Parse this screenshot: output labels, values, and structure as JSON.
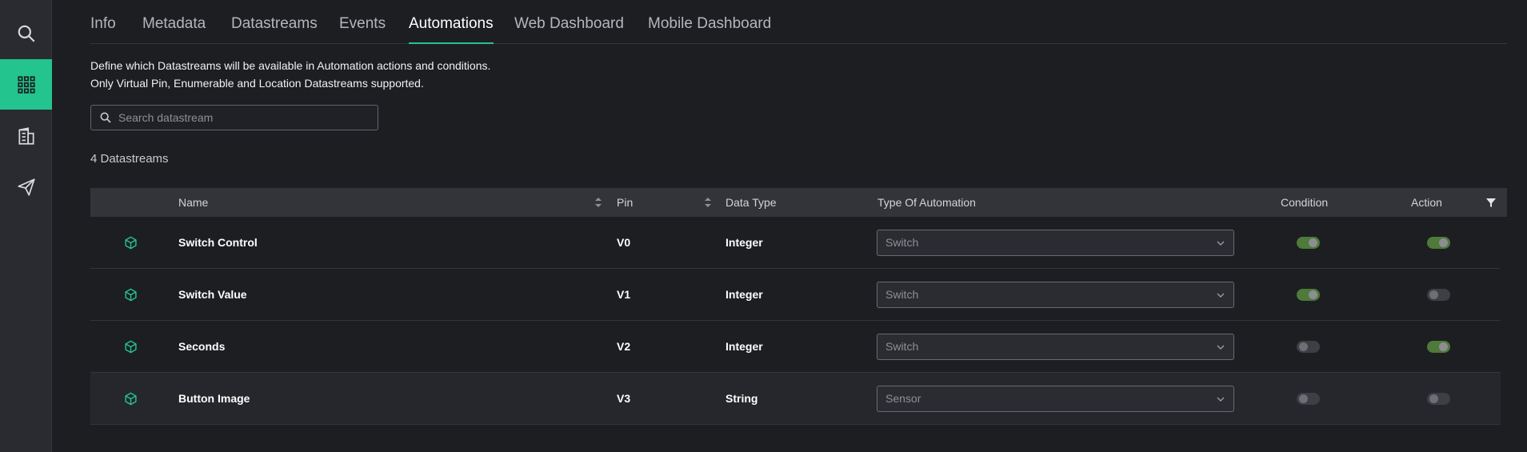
{
  "sidebar": {
    "items": [
      {
        "icon": "search-icon"
      },
      {
        "icon": "grid-icon",
        "active": true
      },
      {
        "icon": "building-icon"
      },
      {
        "icon": "send-icon"
      }
    ]
  },
  "tabs": [
    "Info",
    "Metadata",
    "Datastreams",
    "Events",
    "Automations",
    "Web Dashboard",
    "Mobile Dashboard"
  ],
  "active_tab": "Automations",
  "description": {
    "line1": "Define which Datastreams will be available in Automation actions and conditions.",
    "line2": "Only Virtual Pin, Enumerable and Location Datastreams supported."
  },
  "search": {
    "placeholder": "Search datastream",
    "value": ""
  },
  "count_label": "4 Datastreams",
  "table": {
    "headers": {
      "name": "Name",
      "pin": "Pin",
      "data_type": "Data Type",
      "type_of_automation": "Type Of Automation",
      "condition": "Condition",
      "action": "Action"
    },
    "rows": [
      {
        "name": "Switch Control",
        "pin": "V0",
        "data_type": "Integer",
        "automation": "Switch",
        "condition": true,
        "action": true
      },
      {
        "name": "Switch Value",
        "pin": "V1",
        "data_type": "Integer",
        "automation": "Switch",
        "condition": true,
        "action": false
      },
      {
        "name": "Seconds",
        "pin": "V2",
        "data_type": "Integer",
        "automation": "Switch",
        "condition": false,
        "action": true
      },
      {
        "name": "Button Image",
        "pin": "V3",
        "data_type": "String",
        "automation": "Sensor",
        "condition": false,
        "action": false
      }
    ]
  },
  "colors": {
    "accent": "#23c48e",
    "background": "#1d1e22",
    "toggle_on": "#4e7a3a"
  }
}
